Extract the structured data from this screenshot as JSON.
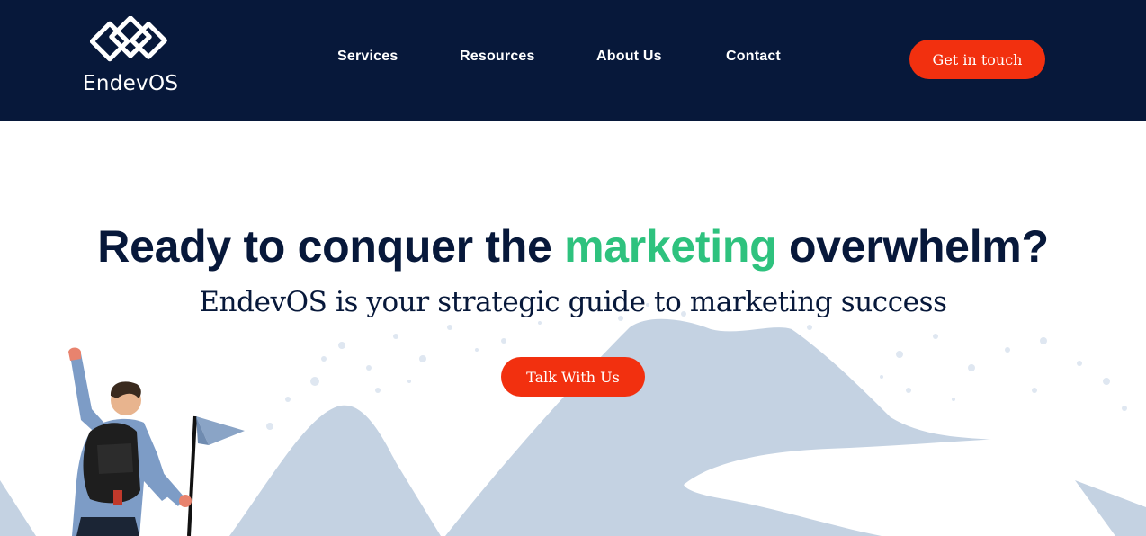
{
  "brand": {
    "name": "EndevOS"
  },
  "nav": {
    "items": [
      {
        "label": "Services"
      },
      {
        "label": "Resources"
      },
      {
        "label": "About Us"
      },
      {
        "label": "Contact"
      }
    ],
    "cta_label": "Get in touch"
  },
  "hero": {
    "headline_before": "Ready to conquer the",
    "headline_accent": "marketing",
    "headline_after": "overwhelm?",
    "subheadline": "EndevOS is your strategic guide to marketing success",
    "cta_label": "Talk With Us"
  },
  "colors": {
    "header_bg": "#07183a",
    "accent_green": "#2ec27e",
    "cta_red": "#f2300f",
    "text_dark": "#07183a",
    "mountain": "#c4d2e2"
  },
  "icons": {
    "logo": "linked-diamonds-logo",
    "illustration": "hiker-with-flag-illustration"
  }
}
